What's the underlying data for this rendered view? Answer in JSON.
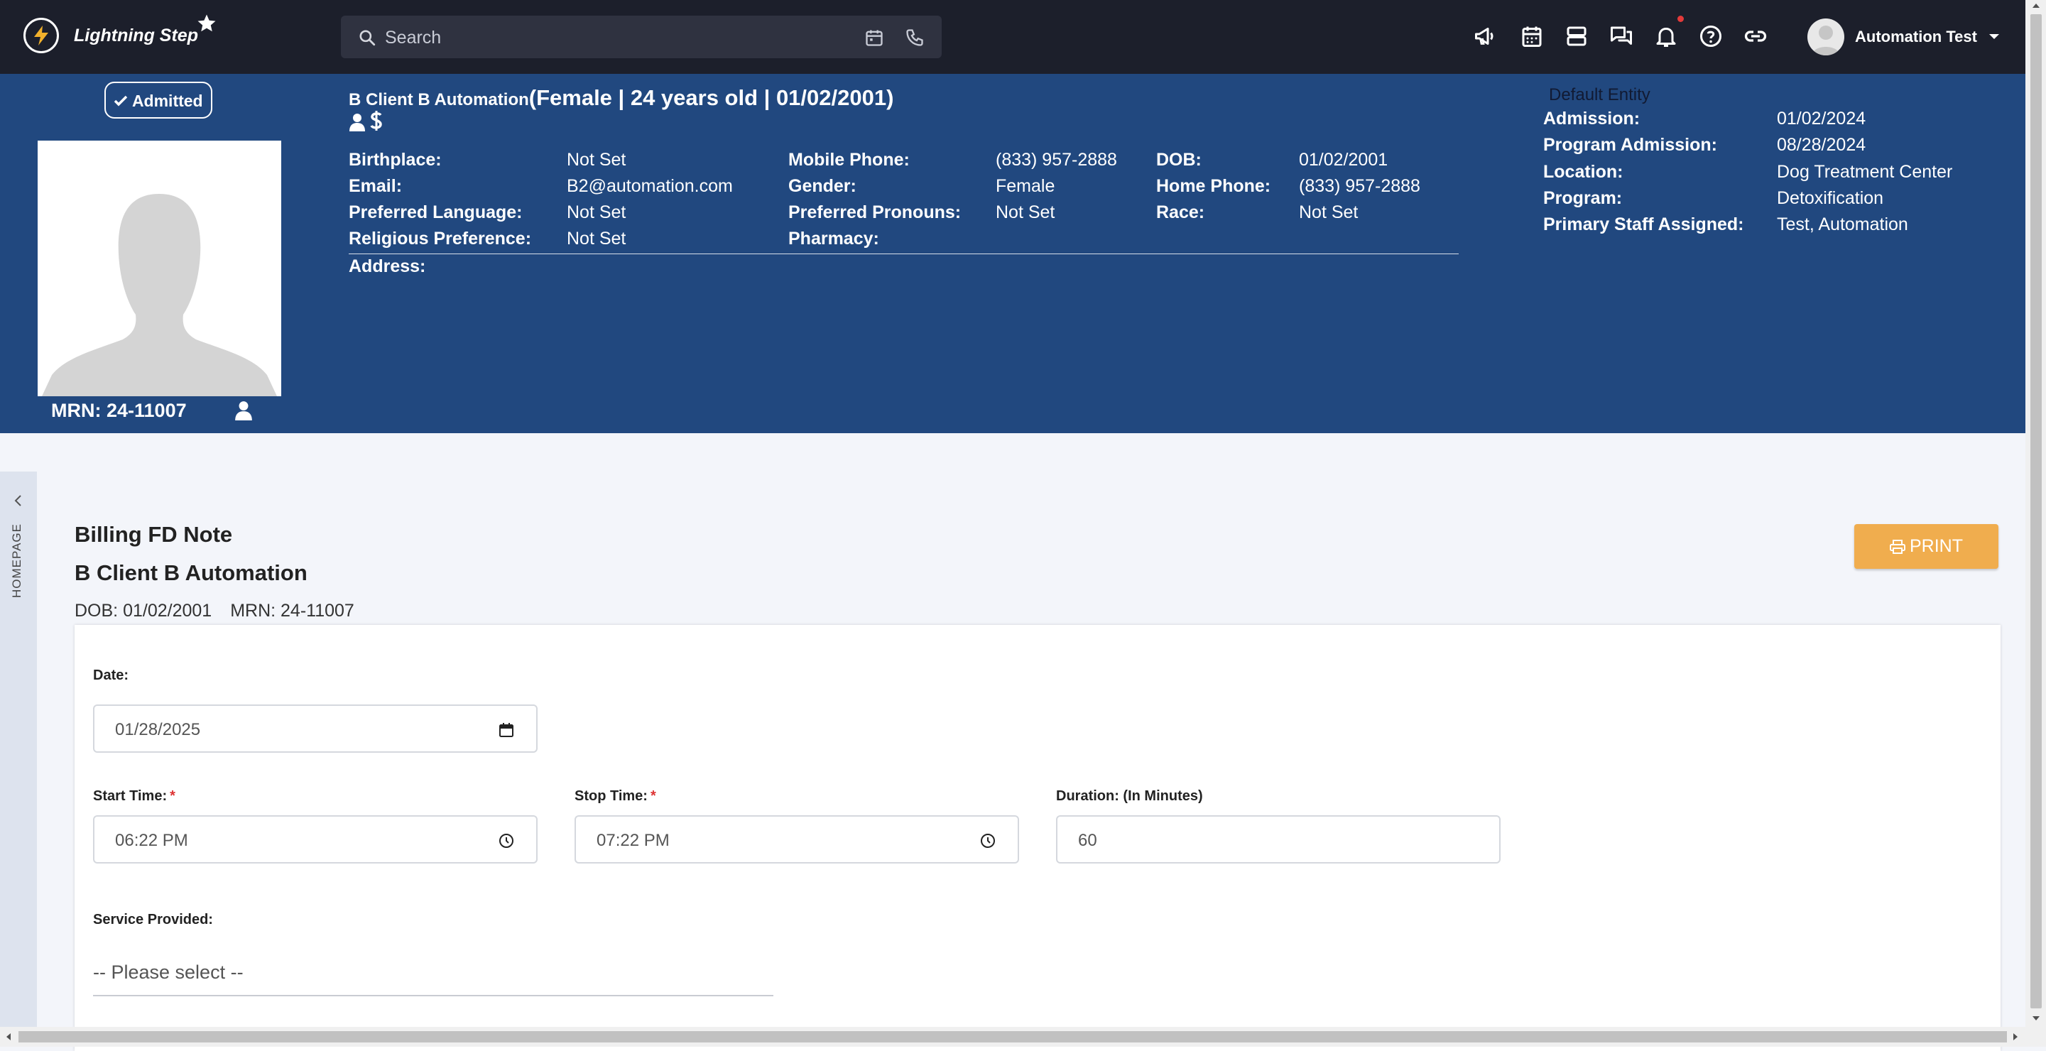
{
  "topbar": {
    "brand": "Lightning Step",
    "search_placeholder": "Search",
    "icons": [
      "megaphone-icon",
      "calendar-icon",
      "server-icon",
      "chat-icon",
      "bell-icon",
      "help-icon",
      "link-icon"
    ],
    "user_name": "Automation Test"
  },
  "patient": {
    "status_badge": "Admitted",
    "name": "B Client B Automation",
    "summary": "(Female | 24 years old | 01/02/2001)",
    "mrn_label": "MRN: 24-11007",
    "col1": [
      {
        "label": "Birthplace:",
        "value": "Not Set"
      },
      {
        "label": "Email:",
        "value": "B2@automation.com"
      },
      {
        "label": "Preferred Language:",
        "value": "Not Set"
      },
      {
        "label": "Religious Preference:",
        "value": "Not Set"
      }
    ],
    "col2": [
      {
        "label": "Mobile Phone:",
        "value": "(833) 957-2888"
      },
      {
        "label": "Gender:",
        "value": "Female"
      },
      {
        "label": "Preferred Pronouns:",
        "value": "Not Set"
      },
      {
        "label": "Pharmacy:",
        "value": ""
      }
    ],
    "col3": [
      {
        "label": "DOB:",
        "value": "01/02/2001"
      },
      {
        "label": "Home Phone:",
        "value": "(833) 957-2888"
      },
      {
        "label": "Race:",
        "value": "Not Set"
      }
    ],
    "address_label": "Address:",
    "entity": "Default Entity",
    "admission": [
      {
        "label": "Admission:",
        "value": "01/02/2024"
      },
      {
        "label": "Program Admission:",
        "value": "08/28/2024"
      },
      {
        "label": "Location:",
        "value": "Dog Treatment Center"
      },
      {
        "label": "Program:",
        "value": "Detoxification"
      },
      {
        "label": "Primary Staff Assigned:",
        "value": "Test, Automation"
      }
    ]
  },
  "sidebar": {
    "tab_label": "HOMEPAGE"
  },
  "note": {
    "title": "Billing FD Note",
    "client": "B Client B Automation",
    "dob": "DOB: 01/02/2001",
    "mrn": "MRN: 24-11007",
    "print_label": "PRINT",
    "date_label": "Date:",
    "date_value": "01/28/2025",
    "start_label": "Start Time:",
    "start_value": "06:22 PM",
    "stop_label": "Stop Time:",
    "stop_value": "07:22 PM",
    "duration_label": "Duration: (In Minutes)",
    "duration_value": "60",
    "service_label": "Service Provided:",
    "service_placeholder": "-- Please select --"
  }
}
